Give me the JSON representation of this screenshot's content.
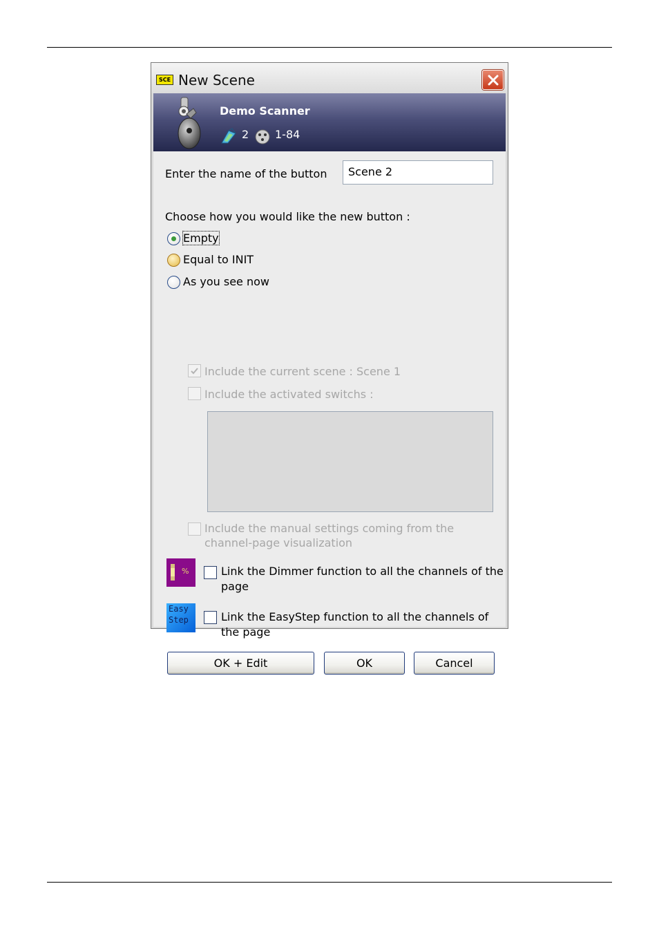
{
  "window": {
    "title": "New Scene",
    "app_badge": "SCE",
    "close_icon": "close-x-icon"
  },
  "device": {
    "name": "Demo Scanner",
    "universe": "2",
    "address": "1-84",
    "icons": [
      "scanner-fixture-icon",
      "universe-globe-icon",
      "dmx-connector-icon"
    ]
  },
  "form": {
    "name_label": "Enter the name of the button",
    "name_value": "Scene 2",
    "choose_label": "Choose how you would like the new button :",
    "options": [
      {
        "label": "Empty",
        "selected": true
      },
      {
        "label": "Equal to INIT",
        "selected": false
      },
      {
        "label": "As you see now",
        "selected": false
      }
    ],
    "include_current_scene": {
      "label": "Include the current scene : Scene 1",
      "checked": true,
      "enabled": false
    },
    "include_activated_switchs": {
      "label": "Include the activated switchs :",
      "checked": false,
      "enabled": false
    },
    "include_manual_settings": {
      "line1": "Include the manual settings coming from the",
      "line2": "channel-page visualization",
      "checked": false,
      "enabled": false
    },
    "link_dimmer": {
      "line1": "Link the Dimmer function to all the channels of the",
      "line2": "page",
      "checked": false,
      "icon": "dimmer-icon",
      "icon_text": "%"
    },
    "link_easystep": {
      "line1": "Link the EasyStep function to all the channels of",
      "line2": "the page",
      "checked": false,
      "icon": "easystep-icon",
      "icon_line1": "Easy",
      "icon_line2": "Step"
    }
  },
  "buttons": {
    "ok_edit": "OK + Edit",
    "ok": "OK",
    "cancel": "Cancel"
  },
  "colors": {
    "banner": "#3a3e66",
    "dialog_bg": "#ececec",
    "close_button": "#c7391a",
    "disabled_text": "#a7a7a7"
  }
}
